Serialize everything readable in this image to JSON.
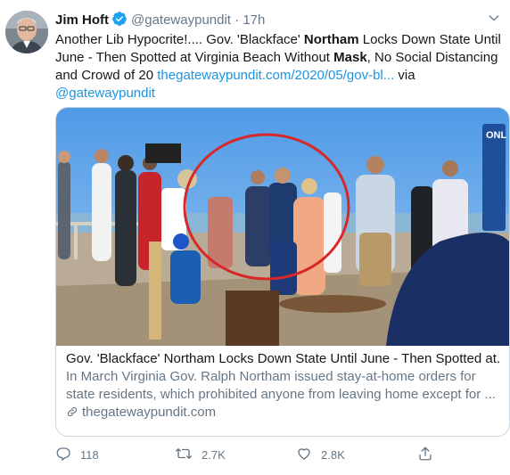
{
  "tweet": {
    "author_name": "Jim Hoft",
    "handle": "@gatewaypundit",
    "separator": "·",
    "time": "17h",
    "text_parts": {
      "p1": "Another Lib Hypocrite!.... Gov. 'Blackface' ",
      "b1": "Northam",
      "p2": " Locks Down State Until June - Then Spotted at Virginia Beach Without ",
      "b2": "Mask",
      "p3": ", No Social Distancing and Crowd of 20 ",
      "link": "thegatewaypundit.com/2020/05/gov-bl...",
      "via": " via ",
      "mention": "@gatewaypundit"
    }
  },
  "card": {
    "title": "Gov. 'Blackface' Northam Locks Down State Until June - Then Spotted at...",
    "description": "In March Virginia Gov. Ralph Northam issued stay-at-home orders for state residents, which prohibited anyone from leaving home except for ...",
    "domain": "thegatewaypundit.com",
    "image_sign_text": "ONL"
  },
  "actions": {
    "replies": "118",
    "retweets": "2.7K",
    "likes": "2.8K"
  },
  "icons": {
    "verified": "verified-badge-icon",
    "caret": "chevron-down-icon",
    "link": "link-icon",
    "reply": "reply-icon",
    "retweet": "retweet-icon",
    "like": "heart-icon",
    "share": "share-icon"
  },
  "colors": {
    "accent": "#1b95e0",
    "text": "#14171a",
    "secondary": "#657786",
    "annotation_circle": "#d62828"
  }
}
